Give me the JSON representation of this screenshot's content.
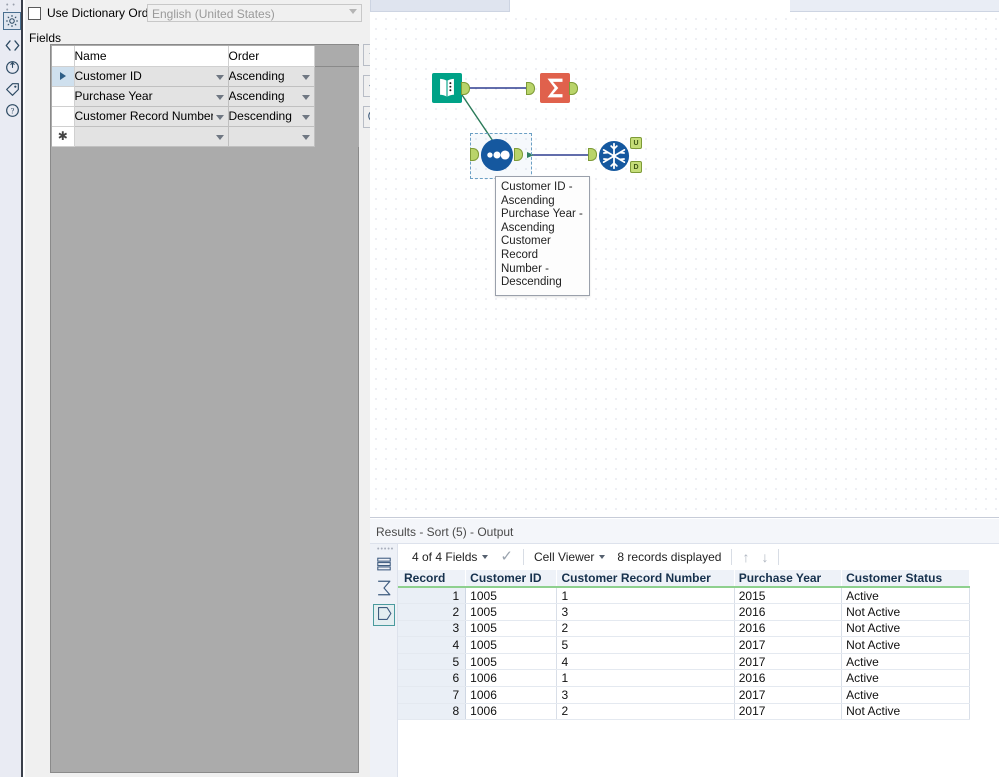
{
  "app": {
    "left_rail_icons": [
      {
        "name": "gear-icon",
        "glyph": "gear",
        "selected": true
      },
      {
        "name": "code-brackets-icon",
        "glyph": "code",
        "selected": false
      },
      {
        "name": "target-arrow-icon",
        "glyph": "target",
        "selected": false
      },
      {
        "name": "tag-icon",
        "glyph": "tag",
        "selected": false
      },
      {
        "name": "help-question-icon",
        "glyph": "question",
        "selected": false
      }
    ]
  },
  "config": {
    "use_dictionary_order": {
      "label": "Use Dictionary Order",
      "checked": false
    },
    "language": {
      "value": "English (United States)",
      "enabled": false
    },
    "fields_label": "Fields",
    "columns": [
      "Name",
      "Order"
    ],
    "rows": [
      {
        "selected": true,
        "marker": "▶",
        "name": "Customer ID",
        "order": "Ascending"
      },
      {
        "selected": false,
        "marker": "",
        "name": "Purchase Year",
        "order": "Ascending"
      },
      {
        "selected": false,
        "marker": "",
        "name": "Customer Record Number",
        "order": "Descending"
      },
      {
        "selected": false,
        "marker": "✱",
        "name": "",
        "order": ""
      }
    ],
    "buttons": [
      {
        "name": "move-up-button",
        "glyph": "arrow-up"
      },
      {
        "name": "move-down-button",
        "glyph": "arrow-down"
      },
      {
        "name": "remove-field-button",
        "glyph": "minus-circle"
      }
    ]
  },
  "canvas": {
    "nodes": [
      {
        "id": "input-data-tool",
        "icon": "book-icon",
        "color": "#00a08a",
        "selected": false
      },
      {
        "id": "summarize-tool",
        "icon": "sigma-icon",
        "color": "#e05a47",
        "selected": false
      },
      {
        "id": "sort-tool",
        "icon": "three-dots-icon",
        "color": "#1a5ea8",
        "selected": true
      },
      {
        "id": "unique-tool",
        "icon": "snowflake-icon",
        "color": "#1a5ea8",
        "selected": false
      }
    ],
    "unique_output_labels": [
      "U",
      "D"
    ],
    "tooltip": {
      "lines": [
        "Customer ID -",
        "Ascending",
        "Purchase Year -",
        "Ascending",
        "Customer Record",
        "Number -",
        "Descending"
      ]
    }
  },
  "results": {
    "title": "Results - Sort (5) - Output",
    "rail_icons": [
      {
        "name": "data-layers-icon",
        "selected": false
      },
      {
        "name": "sigma-summary-icon",
        "selected": false
      },
      {
        "name": "output-pentagon-icon",
        "selected": true
      }
    ],
    "toolbar": {
      "fields_label": "4 of 4 Fields",
      "check_glyph": "✓",
      "viewer_label": "Cell Viewer",
      "records_label": "8 records displayed",
      "nav_up": "↑",
      "nav_down": "↓"
    },
    "table": {
      "columns": [
        "Record",
        "Customer ID",
        "Customer Record Number",
        "Purchase Year",
        "Customer Status"
      ],
      "rows": [
        {
          "record": "1",
          "customer_id": "1005",
          "customer_record_number": "1",
          "purchase_year": "2015",
          "customer_status": "Active"
        },
        {
          "record": "2",
          "customer_id": "1005",
          "customer_record_number": "3",
          "purchase_year": "2016",
          "customer_status": "Not Active"
        },
        {
          "record": "3",
          "customer_id": "1005",
          "customer_record_number": "2",
          "purchase_year": "2016",
          "customer_status": "Not Active"
        },
        {
          "record": "4",
          "customer_id": "1005",
          "customer_record_number": "5",
          "purchase_year": "2017",
          "customer_status": "Not Active"
        },
        {
          "record": "5",
          "customer_id": "1005",
          "customer_record_number": "4",
          "purchase_year": "2017",
          "customer_status": "Active"
        },
        {
          "record": "6",
          "customer_id": "1006",
          "customer_record_number": "1",
          "purchase_year": "2016",
          "customer_status": "Active"
        },
        {
          "record": "7",
          "customer_id": "1006",
          "customer_record_number": "3",
          "purchase_year": "2017",
          "customer_status": "Active"
        },
        {
          "record": "8",
          "customer_id": "1006",
          "customer_record_number": "2",
          "purchase_year": "2017",
          "customer_status": "Not Active"
        }
      ]
    }
  }
}
